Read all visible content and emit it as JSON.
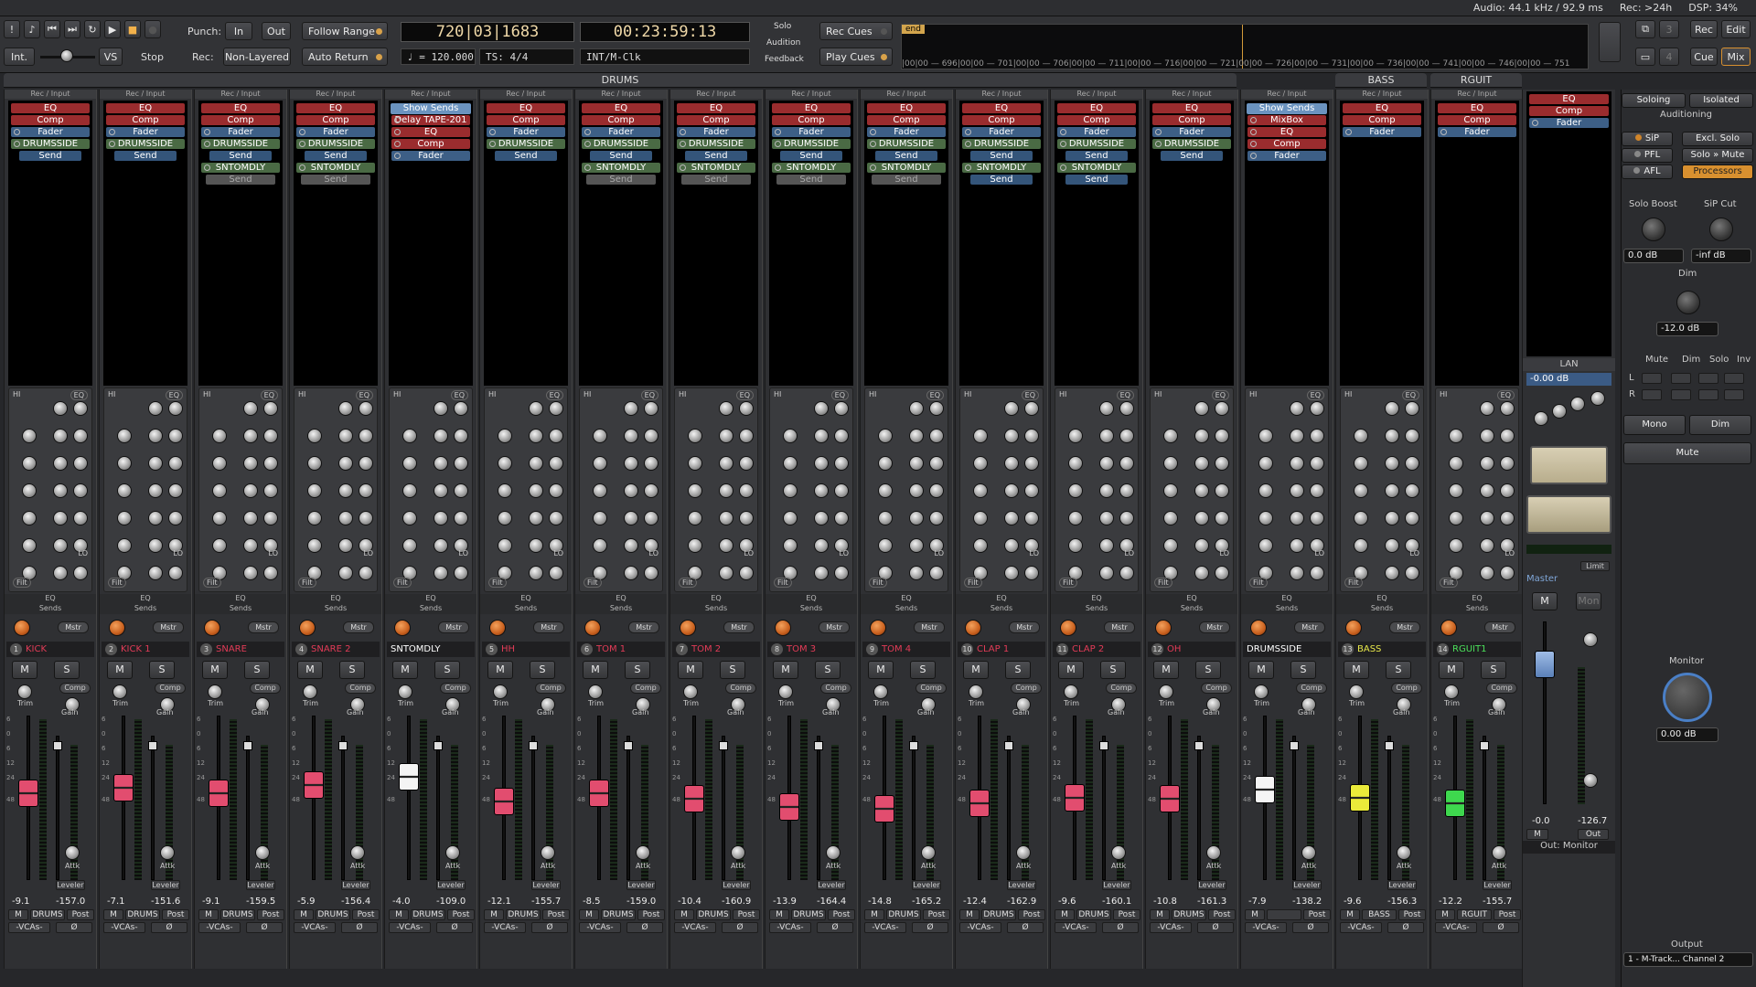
{
  "status": {
    "audio": "Audio: 44.1 kHz / 92.9 ms",
    "rec": "Rec: >24h",
    "dsp": "DSP: 34%"
  },
  "transport": {
    "int": "Int.",
    "vs": "VS",
    "stop": "Stop",
    "punch": "Punch:",
    "in": "In",
    "out": "Out",
    "rec": "Rec:",
    "nonlayered": "Non-Layered",
    "follow": "Follow Range",
    "autoreturn": "Auto Return",
    "bars": "720|03|1683",
    "time": "00:23:59:13",
    "tempo": "♩ = 120.000",
    "ts": "TS: 4/4",
    "clock": "INT/M-Clk",
    "solo": "Solo",
    "audition": "Audition",
    "feedback": "Feedback",
    "reccues": "Rec Cues",
    "playcues": "Play Cues",
    "end": "end",
    "ruler": "|00|00 — 696|00|00 — 701|00|00 — 706|00|00 — 711|00|00 — 716|00|00 — 721|00|00 — 726|00|00 — 731|00|00 — 736|00|00 — 741|00|00 — 746|00|00 — 751",
    "recbtn": "Rec",
    "edit": "Edit",
    "cue": "Cue",
    "mix": "Mix",
    "n3": "3",
    "n4": "4"
  },
  "groups": {
    "drums": "DRUMS",
    "bass": "BASS",
    "rguit": "RGUIT"
  },
  "labels": {
    "recinput": "Rec / Input",
    "eq": "EQ",
    "sends": "Sends",
    "mstr": "Mstr",
    "comp": "Comp",
    "trim": "Trim",
    "gain": "Gain",
    "attk": "Attk",
    "leveler": "Leveler",
    "m": "M",
    "s": "S",
    "vcas": "-VCAs-",
    "phase": "Ø",
    "post": "Post",
    "hi": "HI",
    "lo": "LO",
    "filt": "Filt"
  },
  "strips": [
    {
      "num": "1",
      "name": "KICK",
      "color": "#e23b57",
      "vol": "-9.1",
      "pk": "-157.0",
      "fader": "#e24d6f",
      "fpos": 0.42,
      "bus": "DRUMS",
      "inserts": [
        [
          "EQ",
          "red"
        ],
        [
          "Comp",
          "red"
        ],
        [
          "Fader",
          "blue"
        ],
        [
          "DRUMSSIDE",
          "green"
        ],
        [
          "Send",
          "sendb"
        ]
      ]
    },
    {
      "num": "2",
      "name": "KICK 1",
      "color": "#e23b57",
      "vol": "-7.1",
      "pk": "-151.6",
      "fader": "#e24d6f",
      "fpos": 0.38,
      "bus": "DRUMS",
      "inserts": [
        [
          "EQ",
          "red"
        ],
        [
          "Comp",
          "red"
        ],
        [
          "Fader",
          "blue"
        ],
        [
          "DRUMSSIDE",
          "green"
        ],
        [
          "Send",
          "sendb"
        ]
      ]
    },
    {
      "num": "3",
      "name": "SNARE",
      "color": "#e23b57",
      "vol": "-9.1",
      "pk": "-159.5",
      "fader": "#e24d6f",
      "fpos": 0.42,
      "bus": "DRUMS",
      "inserts": [
        [
          "EQ",
          "red"
        ],
        [
          "Comp",
          "red"
        ],
        [
          "Fader",
          "blue"
        ],
        [
          "DRUMSSIDE",
          "green"
        ],
        [
          "Send",
          "sendb"
        ],
        [
          "SNTOMDLY",
          "green"
        ],
        [
          "Send",
          "sendg"
        ]
      ]
    },
    {
      "num": "4",
      "name": "SNARE 2",
      "color": "#e23b57",
      "vol": "-5.9",
      "pk": "-156.4",
      "fader": "#e24d6f",
      "fpos": 0.36,
      "bus": "DRUMS",
      "inserts": [
        [
          "EQ",
          "red"
        ],
        [
          "Comp",
          "red"
        ],
        [
          "Fader",
          "blue"
        ],
        [
          "DRUMSSIDE",
          "green"
        ],
        [
          "Send",
          "sendb"
        ],
        [
          "SNTOMDLY",
          "green"
        ],
        [
          "Send",
          "sendg"
        ]
      ]
    },
    {
      "num": "",
      "name": "SNTOMDLY",
      "color": "#ffffff",
      "vol": "-4.0",
      "pk": "-109.0",
      "fader": "#f4f4f4",
      "fpos": 0.3,
      "bus": "DRUMS",
      "show": true,
      "inserts": [
        [
          "Delay TAPE-201",
          "red"
        ],
        [
          "EQ",
          "red"
        ],
        [
          "Comp",
          "red"
        ],
        [
          "Fader",
          "blue"
        ]
      ]
    },
    {
      "num": "5",
      "name": "HH",
      "color": "#e23b57",
      "vol": "-12.1",
      "pk": "-155.7",
      "fader": "#e24d6f",
      "fpos": 0.48,
      "bus": "DRUMS",
      "inserts": [
        [
          "EQ",
          "red"
        ],
        [
          "Comp",
          "red"
        ],
        [
          "Fader",
          "blue"
        ],
        [
          "DRUMSSIDE",
          "green"
        ],
        [
          "Send",
          "sendb"
        ]
      ]
    },
    {
      "num": "6",
      "name": "TOM 1",
      "color": "#e23b57",
      "vol": "-8.5",
      "pk": "-159.0",
      "fader": "#e24d6f",
      "fpos": 0.42,
      "bus": "DRUMS",
      "inserts": [
        [
          "EQ",
          "red"
        ],
        [
          "Comp",
          "red"
        ],
        [
          "Fader",
          "blue"
        ],
        [
          "DRUMSSIDE",
          "green"
        ],
        [
          "Send",
          "sendb"
        ],
        [
          "SNTOMDLY",
          "green"
        ],
        [
          "Send",
          "sendg"
        ]
      ]
    },
    {
      "num": "7",
      "name": "TOM 2",
      "color": "#e23b57",
      "vol": "-10.4",
      "pk": "-160.9",
      "fader": "#e24d6f",
      "fpos": 0.46,
      "bus": "DRUMS",
      "inserts": [
        [
          "EQ",
          "red"
        ],
        [
          "Comp",
          "red"
        ],
        [
          "Fader",
          "blue"
        ],
        [
          "DRUMSSIDE",
          "green"
        ],
        [
          "Send",
          "sendb"
        ],
        [
          "SNTOMDLY",
          "green"
        ],
        [
          "Send",
          "sendg"
        ]
      ]
    },
    {
      "num": "8",
      "name": "TOM 3",
      "color": "#e23b57",
      "vol": "-13.9",
      "pk": "-164.4",
      "fader": "#e24d6f",
      "fpos": 0.52,
      "bus": "DRUMS",
      "inserts": [
        [
          "EQ",
          "red"
        ],
        [
          "Comp",
          "red"
        ],
        [
          "Fader",
          "blue"
        ],
        [
          "DRUMSSIDE",
          "green"
        ],
        [
          "Send",
          "sendb"
        ],
        [
          "SNTOMDLY",
          "green"
        ],
        [
          "Send",
          "sendg"
        ]
      ]
    },
    {
      "num": "9",
      "name": "TOM 4",
      "color": "#e23b57",
      "vol": "-14.8",
      "pk": "-165.2",
      "fader": "#e24d6f",
      "fpos": 0.53,
      "bus": "DRUMS",
      "inserts": [
        [
          "EQ",
          "red"
        ],
        [
          "Comp",
          "red"
        ],
        [
          "Fader",
          "blue"
        ],
        [
          "DRUMSSIDE",
          "green"
        ],
        [
          "Send",
          "sendb"
        ],
        [
          "SNTOMDLY",
          "green"
        ],
        [
          "Send",
          "sendg"
        ]
      ]
    },
    {
      "num": "10",
      "name": "CLAP 1",
      "color": "#e23b57",
      "vol": "-12.4",
      "pk": "-162.9",
      "fader": "#e24d6f",
      "fpos": 0.49,
      "bus": "DRUMS",
      "inserts": [
        [
          "EQ",
          "red"
        ],
        [
          "Comp",
          "red"
        ],
        [
          "Fader",
          "blue"
        ],
        [
          "DRUMSSIDE",
          "green"
        ],
        [
          "Send",
          "sendb"
        ],
        [
          "SNTOMDLY",
          "green"
        ],
        [
          "Send",
          "sendb"
        ]
      ]
    },
    {
      "num": "11",
      "name": "CLAP 2",
      "color": "#e23b57",
      "vol": "-9.6",
      "pk": "-160.1",
      "fader": "#e24d6f",
      "fpos": 0.45,
      "bus": "DRUMS",
      "inserts": [
        [
          "EQ",
          "red"
        ],
        [
          "Comp",
          "red"
        ],
        [
          "Fader",
          "blue"
        ],
        [
          "DRUMSSIDE",
          "green"
        ],
        [
          "Send",
          "sendb"
        ],
        [
          "SNTOMDLY",
          "green"
        ],
        [
          "Send",
          "sendb"
        ]
      ]
    },
    {
      "num": "12",
      "name": "OH",
      "color": "#e23b57",
      "vol": "-10.8",
      "pk": "-161.3",
      "fader": "#e24d6f",
      "fpos": 0.46,
      "bus": "DRUMS",
      "inserts": [
        [
          "EQ",
          "red"
        ],
        [
          "Comp",
          "red"
        ],
        [
          "Fader",
          "blue"
        ],
        [
          "DRUMSSIDE",
          "green"
        ],
        [
          "Send",
          "sendb"
        ]
      ]
    },
    {
      "num": "",
      "name": "DRUMSSIDE",
      "color": "#ffffff",
      "vol": "-7.9",
      "pk": "-138.2",
      "fader": "#f4f4f4",
      "fpos": 0.39,
      "bus": "",
      "show": true,
      "inserts": [
        [
          "MixBox",
          "red"
        ],
        [
          "EQ",
          "red"
        ],
        [
          "Comp",
          "red"
        ],
        [
          "Fader",
          "blue"
        ]
      ]
    },
    {
      "num": "13",
      "name": "BASS",
      "color": "#e8e84a",
      "vol": "-9.6",
      "pk": "-156.3",
      "fader": "#eaea3a",
      "fpos": 0.45,
      "bus": "BASS",
      "inserts": [
        [
          "EQ",
          "red"
        ],
        [
          "Comp",
          "red"
        ],
        [
          "Fader",
          "blue"
        ]
      ]
    },
    {
      "num": "14",
      "name": "RGUIT1",
      "color": "#4be05a",
      "vol": "-12.2",
      "pk": "-155.7",
      "fader": "#3ed84e",
      "fpos": 0.49,
      "bus": "RGUIT",
      "inserts": [
        [
          "EQ",
          "red"
        ],
        [
          "Comp",
          "red"
        ],
        [
          "Fader",
          "blue"
        ]
      ]
    }
  ],
  "master": {
    "lan": "LAN",
    "db": "-0.00 dB",
    "name": "Master",
    "vol": "-0.0",
    "pk": "-126.7",
    "limit": "Limit",
    "outmonitor": "Out: Monitor",
    "m": "M",
    "out": "Out",
    "mon": "Mon"
  },
  "right": {
    "soloing": "Soloing",
    "isolated": "Isolated",
    "auditioning": "Auditioning",
    "sip": "SiP",
    "exclsolo": "Excl. Solo",
    "pfl": "PFL",
    "solomute": "Solo » Mute",
    "afl": "AFL",
    "processors": "Processors",
    "soloboost": "Solo Boost",
    "sipcut": "SiP Cut",
    "boostval": "0.0 dB",
    "sipval": "-inf dB",
    "dim": "Dim",
    "dimval": "-12.0 dB",
    "mute": "Mute",
    "dimh": "Dim",
    "solo": "Solo",
    "inv": "Inv",
    "l": "L",
    "r": "R",
    "mono": "Mono",
    "dimbtn": "Dim",
    "mutebtn": "Mute",
    "monitor": "Monitor",
    "monval": "0.00 dB",
    "output": "Output",
    "outval": "1 - M-Track... Channel 2"
  }
}
